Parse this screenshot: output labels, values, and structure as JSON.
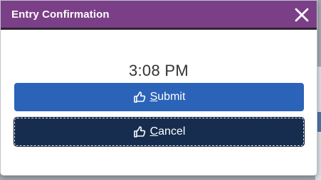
{
  "dialog": {
    "title": "Entry Confirmation",
    "time": "3:08 PM"
  },
  "buttons": {
    "submit_label_first": "S",
    "submit_label_rest": "ubmit",
    "cancel_label_first": "C",
    "cancel_label_rest": "ancel"
  },
  "icons": {
    "close": "close-icon",
    "thumb": "thumbs-up-icon"
  },
  "colors": {
    "titlebar": "#7b3f87",
    "submit": "#2a63b8",
    "cancel": "#172d4f"
  }
}
